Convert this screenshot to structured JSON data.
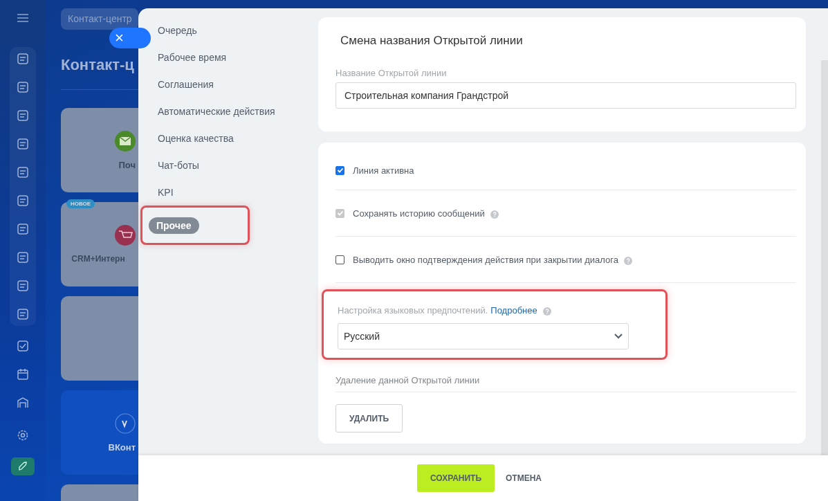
{
  "background_page": {
    "breadcrumb": "Контакт-центр",
    "title": "Контакт-ц",
    "tiles": [
      {
        "kind": "mail",
        "label": "Поч"
      },
      {
        "kind": "shop",
        "label": "CRM+Интерн",
        "badge": "НОВОЕ"
      },
      {
        "kind": "blank"
      },
      {
        "kind": "vk",
        "label": "ВКонт"
      },
      {
        "kind": "blank"
      }
    ]
  },
  "close_button": "×",
  "nav": [
    {
      "label": "Очередь",
      "selected": false
    },
    {
      "label": "Рабочее время",
      "selected": false
    },
    {
      "label": "Соглашения",
      "selected": false
    },
    {
      "label": "Автоматические действия",
      "selected": false
    },
    {
      "label": "Оценка качества",
      "selected": false
    },
    {
      "label": "Чат-боты",
      "selected": false
    },
    {
      "label": "KPI",
      "selected": false
    },
    {
      "label": "Прочее",
      "selected": true,
      "highlighted": true
    }
  ],
  "name_card": {
    "title": "Смена названия Открытой линии",
    "field_label": "Название Открытой линии",
    "value": "Строительная компания Грандстрой"
  },
  "options": [
    {
      "label": "Линия активна",
      "checked": true,
      "disabled": false,
      "help": false
    },
    {
      "label": "Сохранять историю сообщений",
      "checked": true,
      "disabled": true,
      "help": true
    },
    {
      "label": "Выводить окно подтверждения действия при закрытии диалога",
      "checked": false,
      "disabled": false,
      "help": true
    }
  ],
  "language": {
    "label": "Настройка языковых предпочтений.",
    "link": "Подробнее",
    "value": "Русский",
    "highlighted": true
  },
  "delete": {
    "label": "Удаление данной Открытой линии",
    "button": "УДАЛИТЬ"
  },
  "footer": {
    "save": "СОХРАНИТЬ",
    "cancel": "ОТМЕНА"
  }
}
